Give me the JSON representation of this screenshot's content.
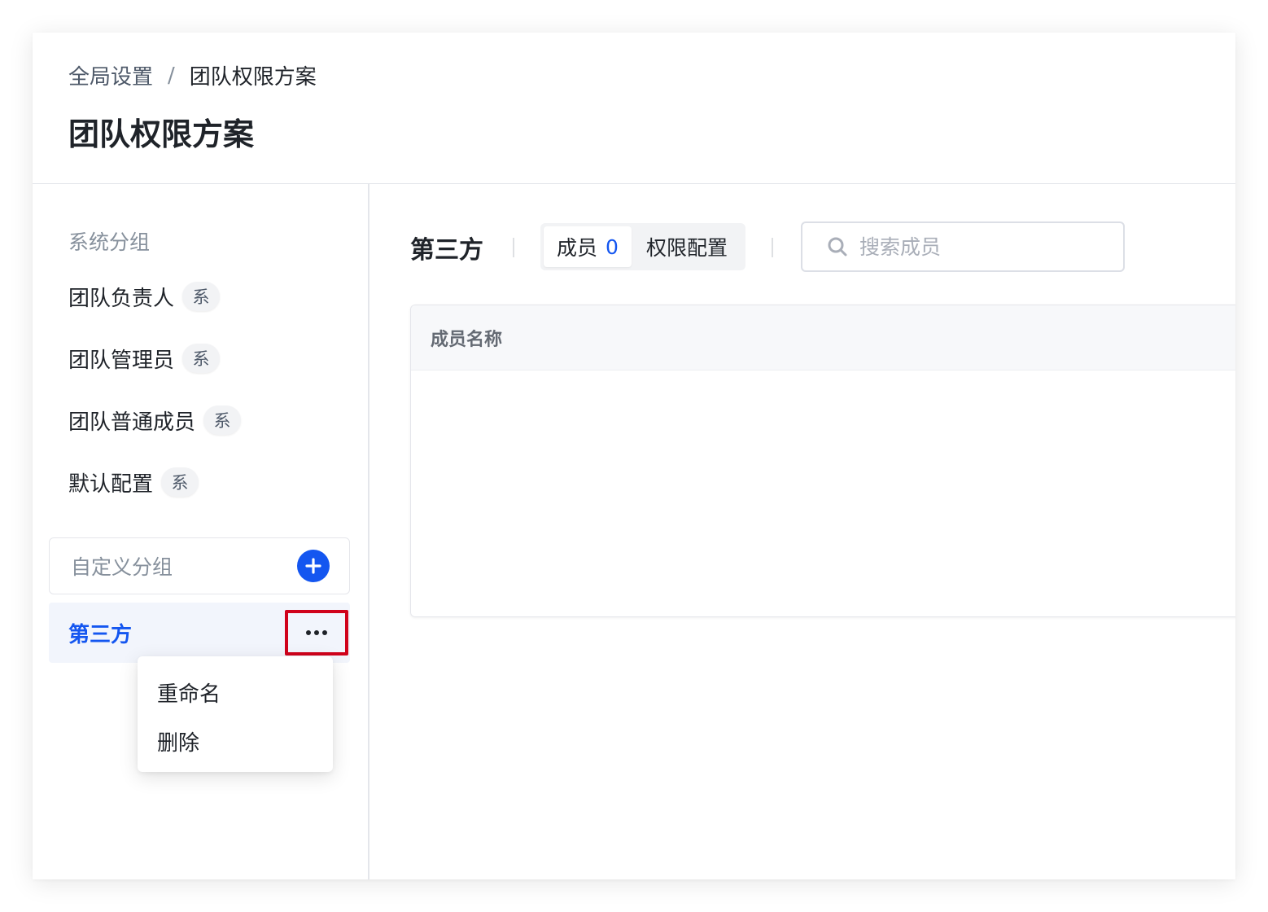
{
  "breadcrumb": {
    "parent": "全局设置",
    "separator": "/",
    "current": "团队权限方案"
  },
  "page_title": "团队权限方案",
  "sidebar": {
    "system_group_title": "系统分组",
    "system_items": [
      {
        "label": "团队负责人",
        "badge": "系"
      },
      {
        "label": "团队管理员",
        "badge": "系"
      },
      {
        "label": "团队普通成员",
        "badge": "系"
      },
      {
        "label": "默认配置",
        "badge": "系"
      }
    ],
    "custom_group_title": "自定义分组",
    "custom_items": [
      {
        "label": "第三方",
        "selected": true
      }
    ],
    "more_menu": [
      {
        "label": "重命名"
      },
      {
        "label": "删除"
      }
    ]
  },
  "main": {
    "group_name": "第三方",
    "tabs": [
      {
        "label": "成员",
        "count": "0",
        "active": true
      },
      {
        "label": "权限配置",
        "active": false
      }
    ],
    "search": {
      "placeholder": "搜索成员",
      "value": ""
    },
    "table": {
      "columns": [
        "成员名称"
      ],
      "rows": []
    }
  },
  "icons": {
    "add": "plus-circle-icon",
    "more": "ellipsis-icon",
    "search": "search-icon"
  },
  "colors": {
    "accent": "#1456f0",
    "highlight_box": "#d0021b",
    "selected_bg": "#f2f5fc"
  }
}
